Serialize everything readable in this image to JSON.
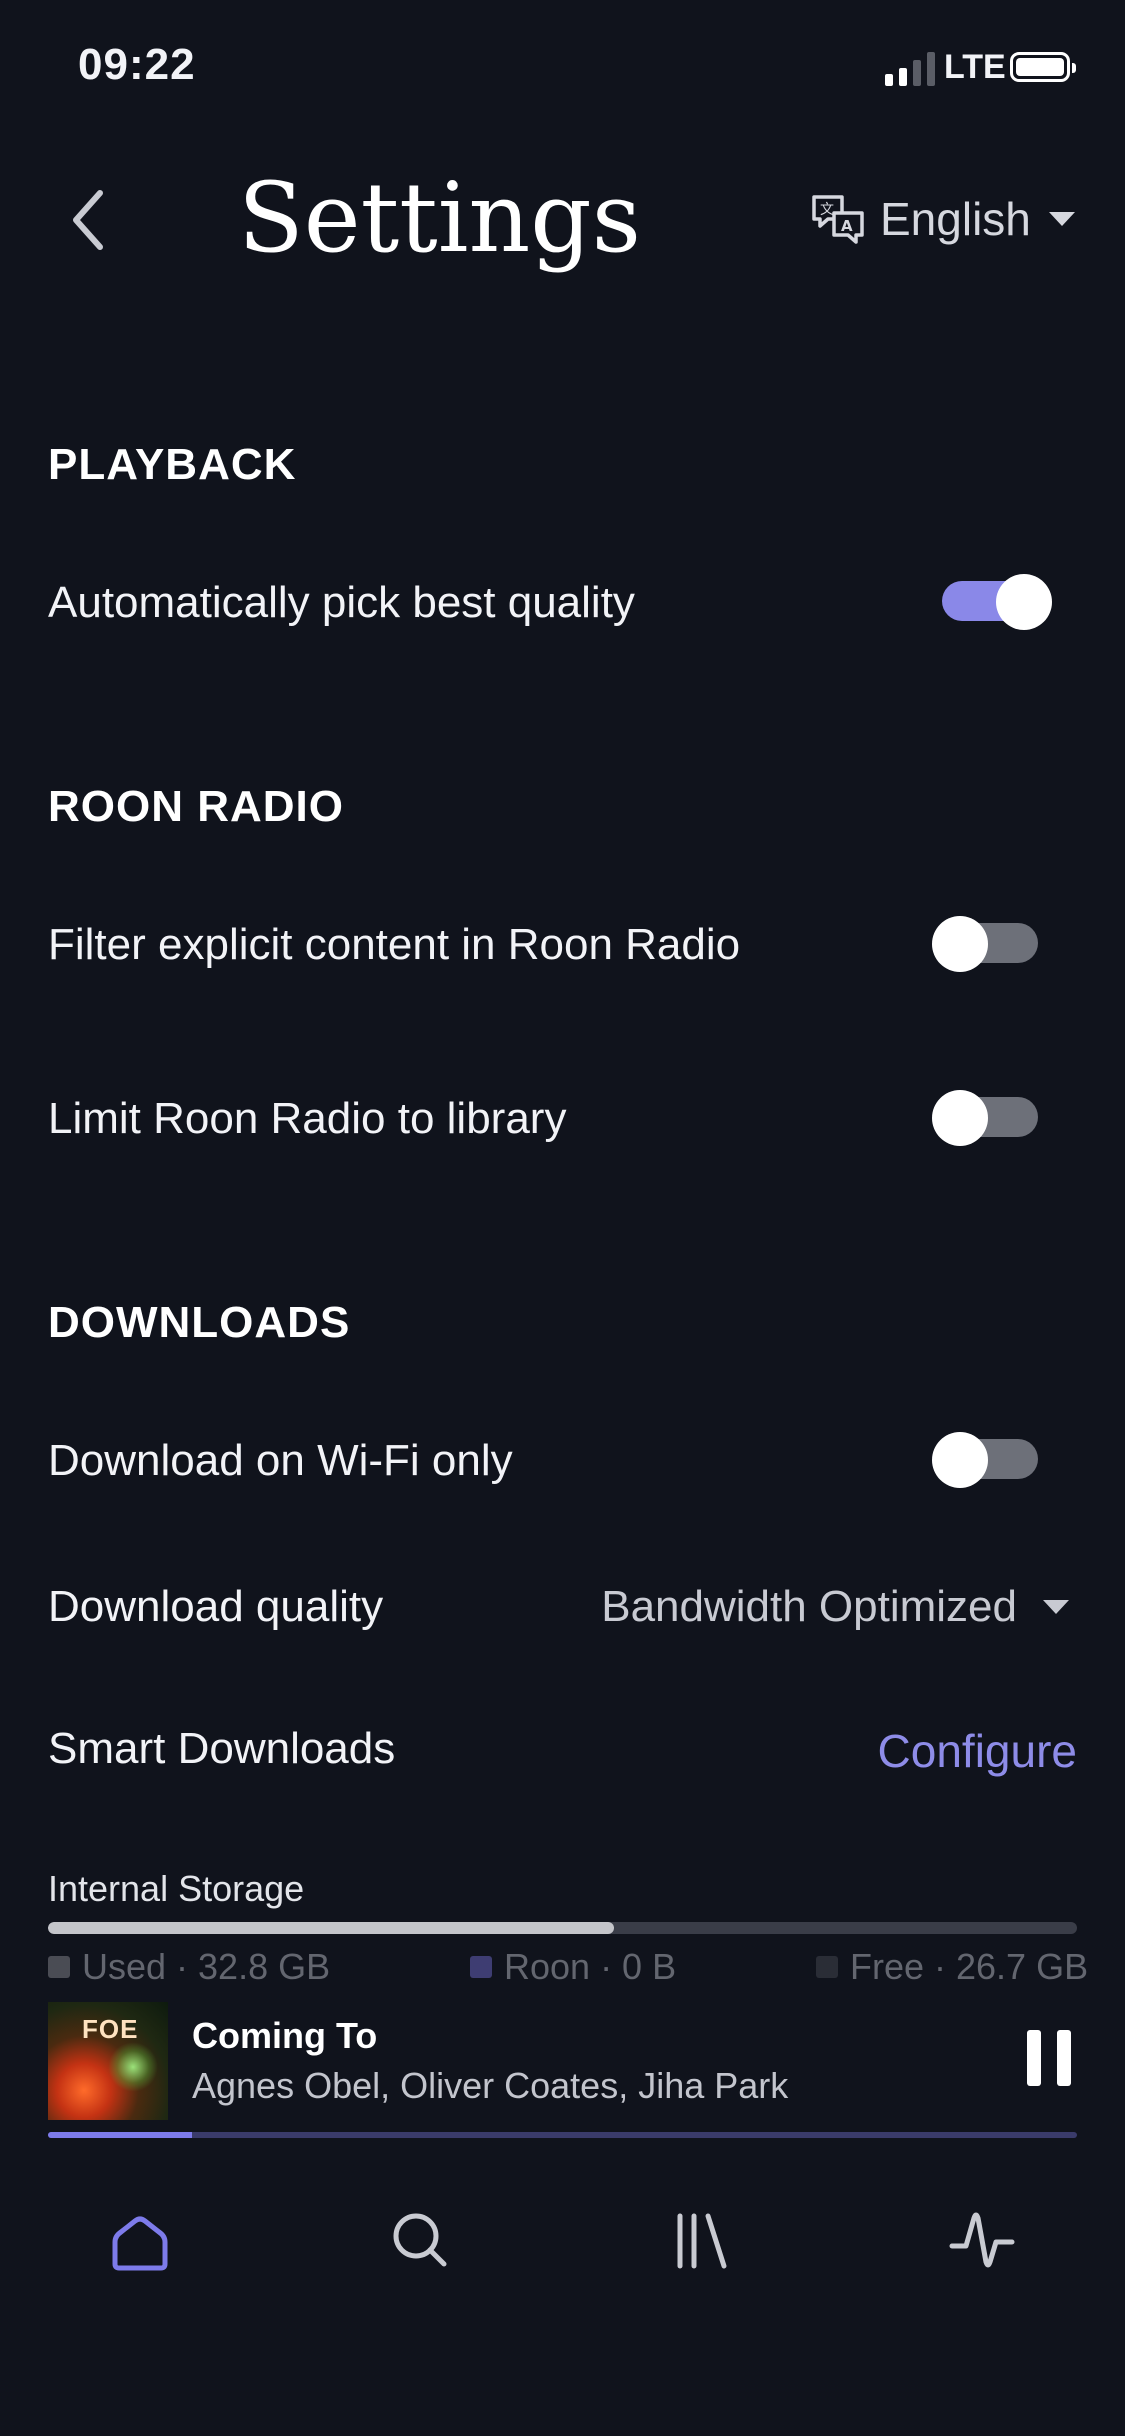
{
  "status_bar": {
    "time": "09:22",
    "network": "LTE"
  },
  "header": {
    "title": "Settings",
    "language": {
      "selected": "English"
    }
  },
  "sections": {
    "playback": {
      "title": "PLAYBACK",
      "auto_quality": {
        "label": "Automatically pick best quality",
        "on": true
      }
    },
    "roon_radio": {
      "title": "ROON RADIO",
      "filter_explicit": {
        "label": "Filter explicit content in Roon Radio",
        "on": false
      },
      "limit_library": {
        "label": "Limit Roon Radio to library",
        "on": false
      }
    },
    "downloads": {
      "title": "DOWNLOADS",
      "wifi_only": {
        "label": "Download on Wi-Fi only",
        "on": false
      },
      "quality": {
        "label": "Download quality",
        "selected": "Bandwidth Optimized"
      },
      "smart": {
        "label": "Smart Downloads",
        "action": "Configure"
      },
      "storage": {
        "label": "Internal Storage",
        "used_fraction": 0.55,
        "legend": {
          "used": "Used · 32.8 GB",
          "roon": "Roon · 0 B",
          "free": "Free · 26.7 GB"
        }
      }
    }
  },
  "now_playing": {
    "art_text": "FOE",
    "title": "Coming To",
    "artist": "Agnes Obel, Oliver Coates, Jiha Park",
    "progress_fraction": 0.14
  },
  "tab_bar": {
    "items": [
      {
        "icon": "home-icon",
        "active": true
      },
      {
        "icon": "search-icon",
        "active": false
      },
      {
        "icon": "library-icon",
        "active": false
      },
      {
        "icon": "waveform-icon",
        "active": false
      }
    ]
  },
  "colors": {
    "background": "#10131c",
    "accent": "#8a88e8",
    "text": "#f2f3f7",
    "muted": "#63666f"
  }
}
